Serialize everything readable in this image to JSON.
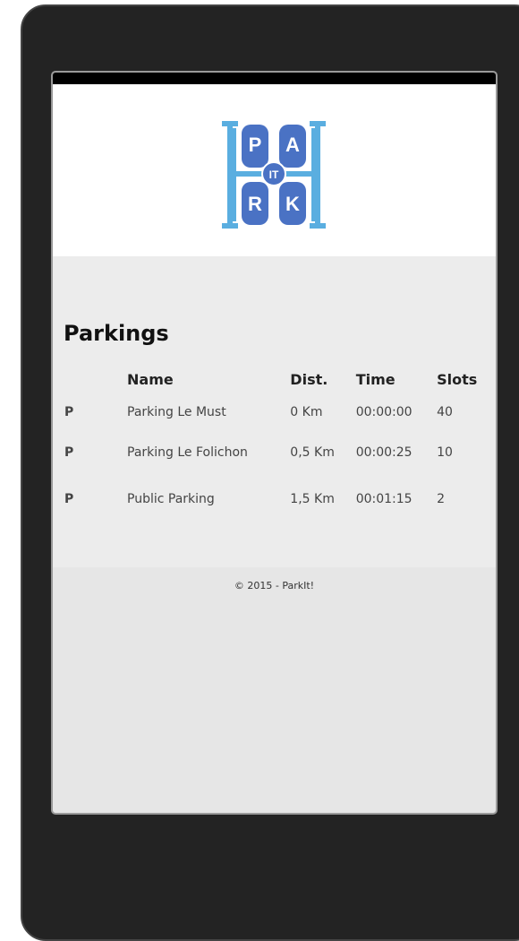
{
  "logo": {
    "letters": [
      "P",
      "A",
      "IT",
      "R",
      "K"
    ],
    "colors": {
      "frame": "#5aaee0",
      "car": "#4a72c4"
    }
  },
  "page": {
    "title": "Parkings"
  },
  "table": {
    "headers": {
      "icon": "",
      "name": "Name",
      "dist": "Dist.",
      "time": "Time",
      "slots": "Slots"
    },
    "rows": [
      {
        "icon": "P",
        "name": "Parking Le Must",
        "dist": "0 Km",
        "time": "00:00:00",
        "slots": "40"
      },
      {
        "icon": "P",
        "name": "Parking Le Folichon",
        "dist": "0,5 Km",
        "time": "00:00:25",
        "slots": "10"
      },
      {
        "icon": "P",
        "name": "Public Parking",
        "dist": "1,5 Km",
        "time": "00:01:15",
        "slots": "2"
      }
    ]
  },
  "footer": {
    "text": "© 2015 - ParkIt!"
  }
}
